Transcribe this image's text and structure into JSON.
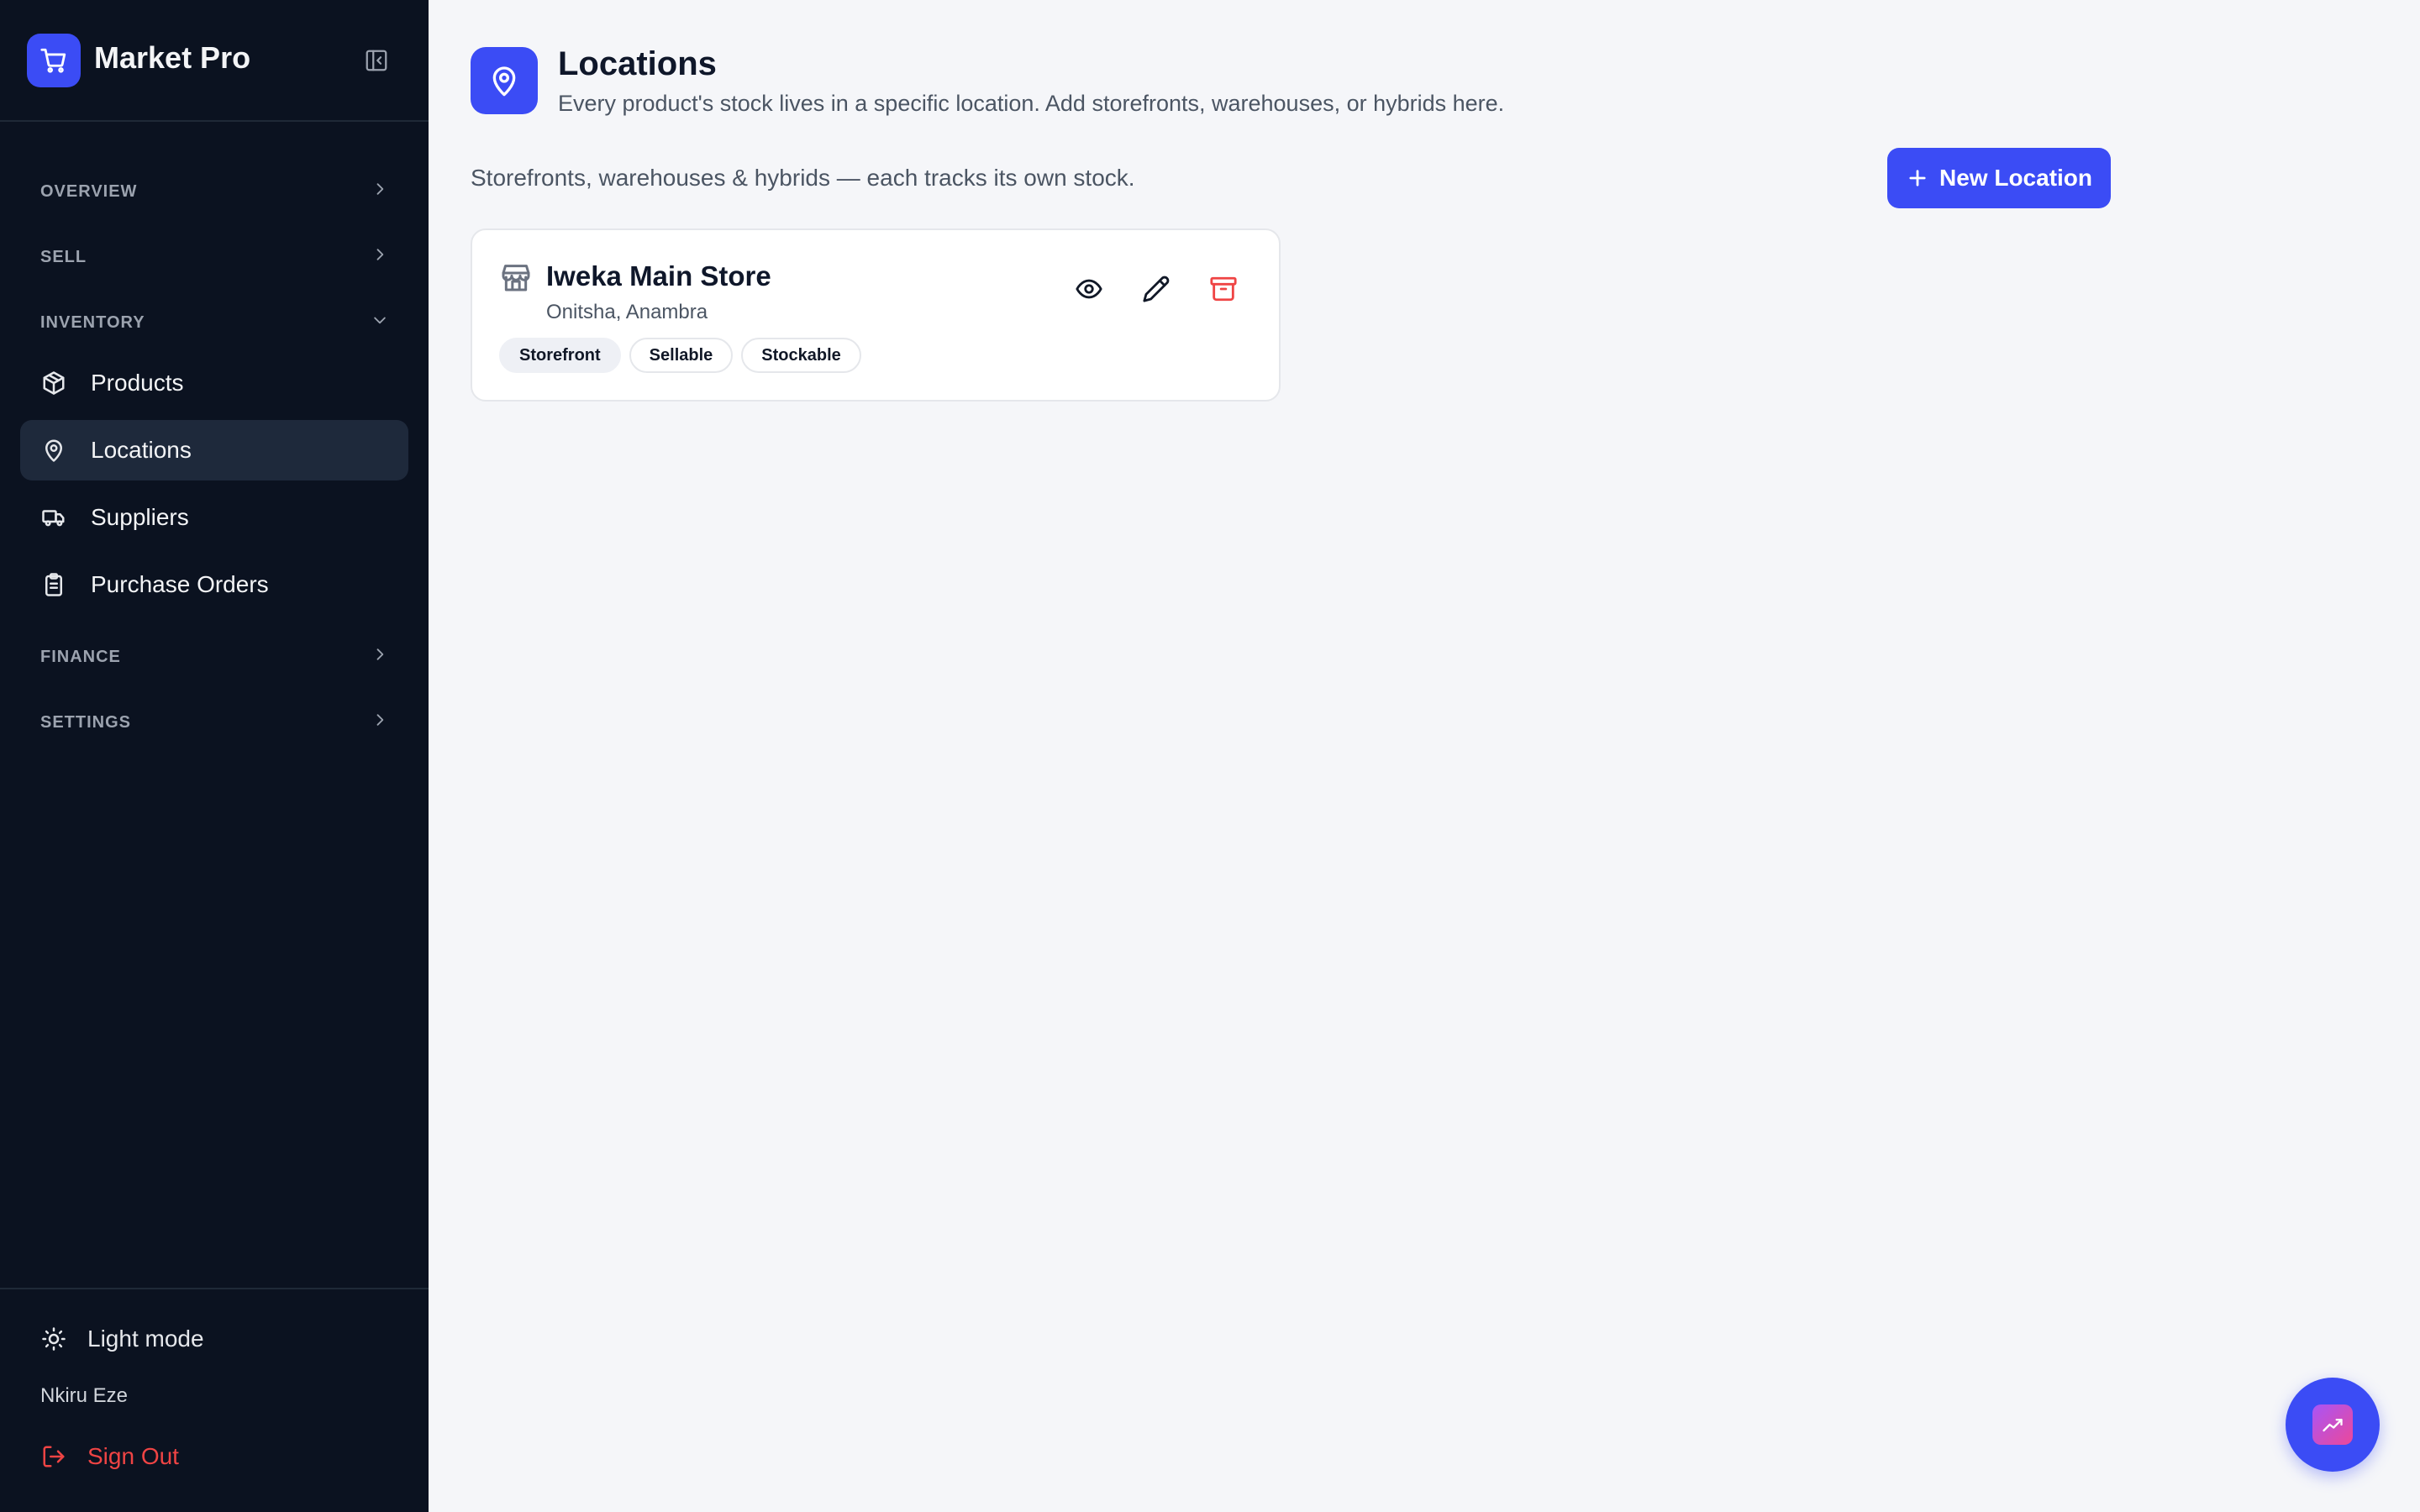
{
  "app": {
    "name": "Market Pro"
  },
  "sidebar": {
    "sections": {
      "overview": "OVERVIEW",
      "sell": "SELL",
      "inventory": "INVENTORY",
      "finance": "FINANCE",
      "settings": "SETTINGS"
    },
    "inventory_items": [
      {
        "label": "Products",
        "icon": "box-icon"
      },
      {
        "label": "Locations",
        "icon": "map-pin-icon",
        "active": true
      },
      {
        "label": "Suppliers",
        "icon": "truck-icon"
      },
      {
        "label": "Purchase Orders",
        "icon": "clipboard-icon"
      }
    ],
    "footer": {
      "theme_toggle": "Light mode",
      "user_name": "Nkiru Eze",
      "sign_out": "Sign Out"
    }
  },
  "page": {
    "title": "Locations",
    "subtitle": "Every product's stock lives in a specific location. Add storefronts, warehouses, or hybrids here.",
    "list_description": "Storefronts, warehouses & hybrids — each tracks its own stock.",
    "new_button": "New Location"
  },
  "locations": [
    {
      "name": "Iweka Main Store",
      "address": "Onitsha, Anambra",
      "tags": [
        "Storefront",
        "Sellable",
        "Stockable"
      ]
    }
  ],
  "colors": {
    "accent": "#3b4cf5",
    "sidebar_bg": "#0b1220",
    "danger": "#ef4444"
  }
}
